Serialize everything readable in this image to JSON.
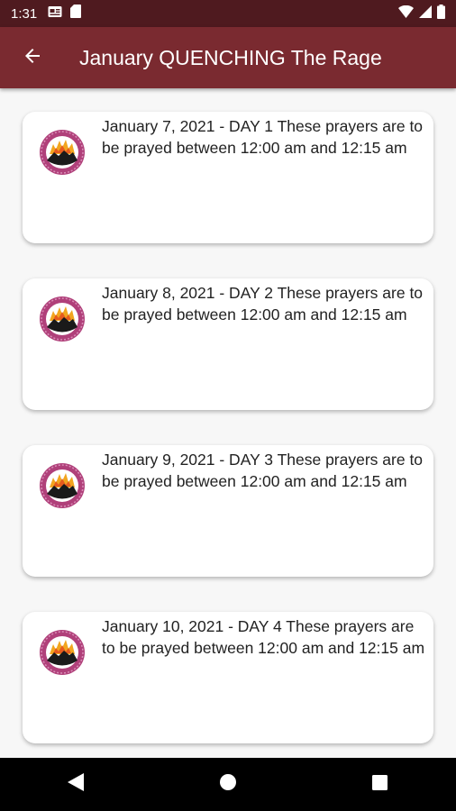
{
  "status_bar": {
    "time": "1:31",
    "left_icons": [
      "news-notification-icon",
      "sd-card-icon"
    ],
    "right_icons": [
      "wifi-icon",
      "cell-signal-icon",
      "battery-icon"
    ]
  },
  "app_bar": {
    "back_icon": "arrow-left-icon",
    "title": "January QUENCHING The Rage"
  },
  "prayers": [
    {
      "text": "January 7, 2021 - DAY 1 These prayers are to be prayed between 12:00 am and 12:15 am",
      "icon": "church-logo-icon"
    },
    {
      "text": "January 8, 2021 - DAY 2 These prayers are to be prayed between 12:00 am and 12:15 am",
      "icon": "church-logo-icon"
    },
    {
      "text": "January 9, 2021 - DAY 3 These prayers are to be prayed between 12:00 am and 12:15 am",
      "icon": "church-logo-icon"
    },
    {
      "text": "January 10, 2021 - DAY 4 These prayers are to be prayed between 12:00 am and 12:15 am",
      "icon": "church-logo-icon"
    }
  ],
  "nav_bar": {
    "buttons": [
      "back-triangle-icon",
      "home-circle-icon",
      "recents-square-icon"
    ]
  },
  "colors": {
    "status_bar": "#4f1a1f",
    "app_bar": "#7a2a30",
    "background": "#f7f7f7",
    "card": "#ffffff",
    "logo_ring": "#b0407a"
  }
}
